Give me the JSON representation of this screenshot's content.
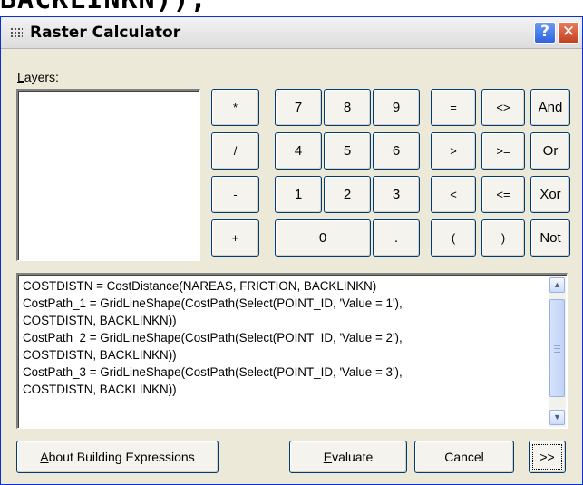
{
  "cutoff_text": "BACKLINKN));",
  "window": {
    "title": "Raster Calculator"
  },
  "title_buttons": {
    "help": "?",
    "close": "✕"
  },
  "layers": {
    "label_mnemonic": "L",
    "label_rest": "ayers:"
  },
  "keypad": {
    "ops": [
      "*",
      "/",
      "-",
      "+"
    ],
    "row1": [
      "7",
      "8",
      "9"
    ],
    "row2": [
      "4",
      "5",
      "6"
    ],
    "row3": [
      "1",
      "2",
      "3"
    ],
    "zero": "0",
    "dot": ".",
    "logic": [
      [
        "=",
        "<>",
        "And"
      ],
      [
        ">",
        ">=",
        "Or"
      ],
      [
        "<",
        "<=",
        "Xor"
      ],
      [
        "(",
        ")",
        "Not"
      ]
    ]
  },
  "expression_lines": [
    "COSTDISTN = CostDistance(NAREAS, FRICTION, BACKLINKN)",
    "CostPath_1 = GridLineShape(CostPath(Select(POINT_ID, 'Value = 1'),",
    "COSTDISTN, BACKLINKN))",
    "CostPath_2 = GridLineShape(CostPath(Select(POINT_ID, 'Value = 2'),",
    "COSTDISTN, BACKLINKN))",
    "CostPath_3 = GridLineShape(CostPath(Select(POINT_ID, 'Value = 3'),",
    "COSTDISTN, BACKLINKN))"
  ],
  "scrollbar": {
    "up_icon": "chevron-up-icon",
    "down_icon": "chevron-down-icon"
  },
  "footer": {
    "about_mnemonic": "A",
    "about_rest": "bout Building Expressions",
    "evaluate_mnemonic": "E",
    "evaluate_rest": "valuate",
    "cancel": "Cancel",
    "expand": ">>"
  }
}
